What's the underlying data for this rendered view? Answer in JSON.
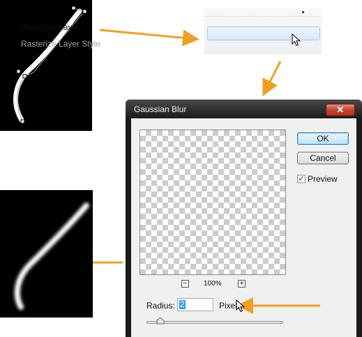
{
  "context_menu": {
    "items": [
      {
        "label": "Rasterize Layer"
      },
      {
        "label": "Rasterize Layer Style"
      }
    ]
  },
  "dialog": {
    "title": "Gaussian Blur",
    "close_symbol": "✕",
    "ok_label": "OK",
    "cancel_label": "Cancel",
    "preview_label": "Preview",
    "preview_checked": true,
    "zoom_out_symbol": "−",
    "zoom_in_symbol": "+",
    "zoom_level": "100%",
    "radius_label": "Radius:",
    "radius_value": "2",
    "units_label": "Pixels"
  },
  "colors": {
    "arrow": "#f0a020",
    "close_button": "#c5442d",
    "selection": "#3399ff"
  },
  "icons": [
    "mouse-pointer-icon",
    "arrow-icon",
    "checkmark-icon",
    "close-icon"
  ]
}
